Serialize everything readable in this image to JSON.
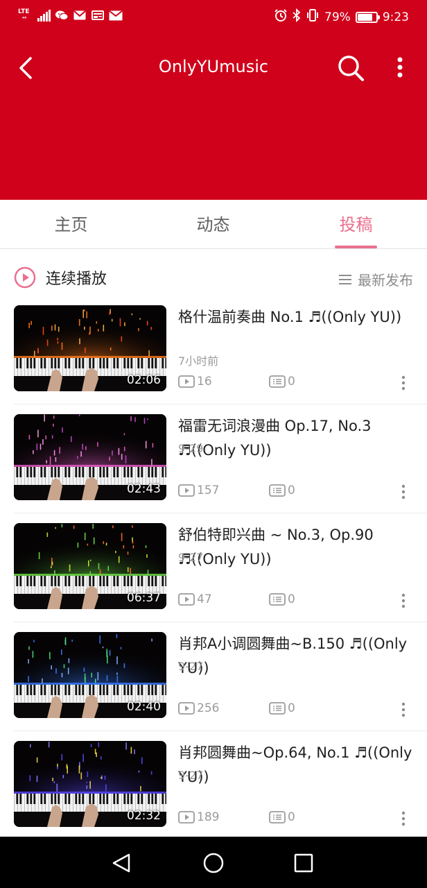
{
  "status_bar": {
    "network": "LTE",
    "battery_percent": "79%",
    "battery_level": 0.79,
    "time": "9:23",
    "left_icons": [
      "signal-icon",
      "wechat-icon",
      "mail-icon",
      "news-icon",
      "email-icon"
    ],
    "right_icons": [
      "alarm-icon",
      "bluetooth-icon",
      "vibrate-icon",
      "battery-icon"
    ]
  },
  "header": {
    "title": "OnlyYUmusic",
    "background": "#d0011b"
  },
  "tabs": [
    {
      "label": "主页",
      "active": false
    },
    {
      "label": "动态",
      "active": false
    },
    {
      "label": "投稿",
      "active": true
    }
  ],
  "accent_color": "#ea6f8e",
  "play_bar": {
    "play_all_label": "连续播放",
    "sort_label": "最新发布"
  },
  "videos": [
    {
      "title": "格什温前奏曲 No.1 ♬((Only YU))",
      "date": "7小时前",
      "views": "16",
      "comments": "0",
      "duration": "02:06",
      "theme": "orange"
    },
    {
      "title": "福雷无词浪漫曲 Op.17, No.3 ♬((Only YU))",
      "date": "9-29",
      "views": "157",
      "comments": "0",
      "duration": "02:43",
      "theme": "pink"
    },
    {
      "title": "舒伯特即兴曲 ~ No.3, Op.90 ♬((Only YU))",
      "date": "9-27",
      "views": "47",
      "comments": "0",
      "duration": "06:37",
      "theme": "green"
    },
    {
      "title": "肖邦A小调圆舞曲~B.150 ♬((Only YU))",
      "date": "9-27",
      "views": "256",
      "comments": "0",
      "duration": "02:40",
      "theme": "blue"
    },
    {
      "title": "肖邦圆舞曲~Op.64, No.1 ♬((Only YU))",
      "date": "9-27",
      "views": "189",
      "comments": "0",
      "duration": "02:32",
      "theme": "indigo"
    }
  ],
  "nav_bar": {
    "icons": [
      "back-triangle-icon",
      "home-circle-icon",
      "recents-square-icon"
    ]
  }
}
